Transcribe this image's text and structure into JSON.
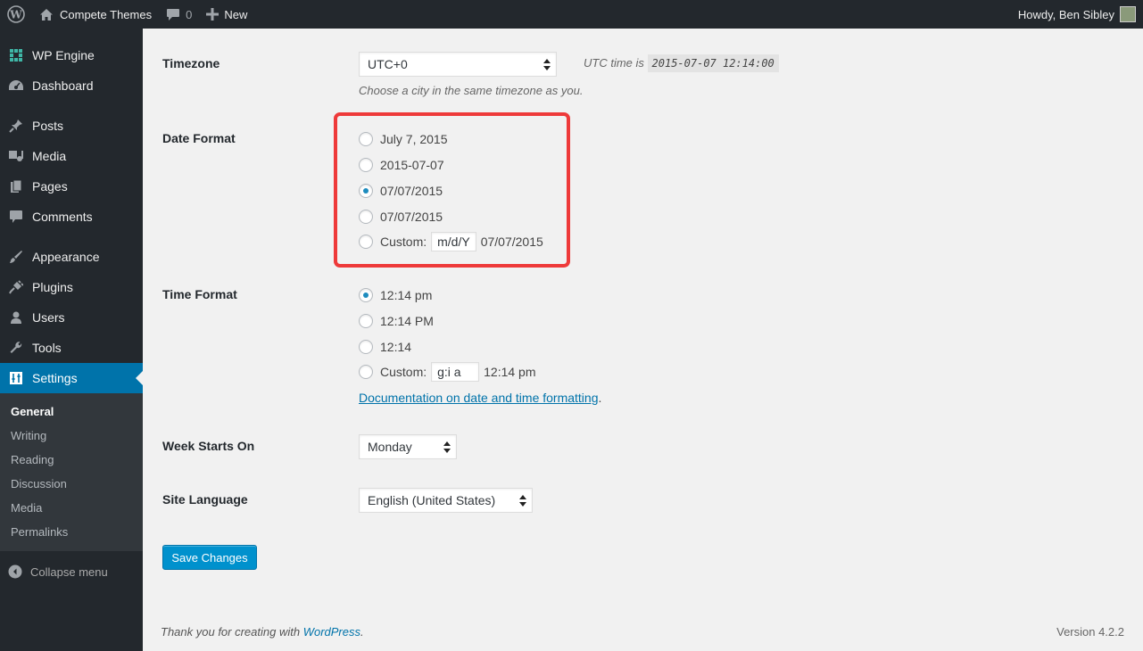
{
  "adminbar": {
    "site_name": "Compete Themes",
    "comments_count": "0",
    "new_label": "New",
    "howdy": "Howdy, Ben Sibley"
  },
  "sidebar": {
    "items": [
      {
        "label": "WP Engine",
        "icon": "wp-engine-icon"
      },
      {
        "label": "Dashboard",
        "icon": "dashboard-icon"
      },
      {
        "label": "Posts",
        "icon": "pin-icon"
      },
      {
        "label": "Media",
        "icon": "media-icon"
      },
      {
        "label": "Pages",
        "icon": "pages-icon"
      },
      {
        "label": "Comments",
        "icon": "comment-icon"
      },
      {
        "label": "Appearance",
        "icon": "brush-icon"
      },
      {
        "label": "Plugins",
        "icon": "plugin-icon"
      },
      {
        "label": "Users",
        "icon": "user-icon"
      },
      {
        "label": "Tools",
        "icon": "wrench-icon"
      },
      {
        "label": "Settings",
        "icon": "settings-icon"
      }
    ],
    "submenu": [
      "General",
      "Writing",
      "Reading",
      "Discussion",
      "Media",
      "Permalinks"
    ],
    "collapse_label": "Collapse menu"
  },
  "timezone": {
    "label": "Timezone",
    "value": "UTC+0",
    "utc_prefix": "UTC time is",
    "utc_time": "2015-07-07 12:14:00",
    "description": "Choose a city in the same timezone as you."
  },
  "date_format": {
    "label": "Date Format",
    "options": [
      "July 7, 2015",
      "2015-07-07",
      "07/07/2015",
      "07/07/2015"
    ],
    "selected_index": 2,
    "custom_label": "Custom:",
    "custom_value": "m/d/Y",
    "custom_preview": "07/07/2015"
  },
  "time_format": {
    "label": "Time Format",
    "options": [
      "12:14 pm",
      "12:14 PM",
      "12:14"
    ],
    "selected_index": 0,
    "custom_label": "Custom:",
    "custom_value": "g:i a",
    "custom_preview": "12:14 pm",
    "doc_link": "Documentation on date and time formatting",
    "doc_suffix": "."
  },
  "week_starts": {
    "label": "Week Starts On",
    "value": "Monday"
  },
  "site_language": {
    "label": "Site Language",
    "value": "English (United States)"
  },
  "save_label": "Save Changes",
  "footer": {
    "thanks_prefix": "Thank you for creating with ",
    "wp_link": "WordPress",
    "thanks_suffix": ".",
    "version": "Version 4.2.2"
  },
  "colors": {
    "accent": "#0073aa",
    "highlight": "#ee3a3a",
    "sidebar_bg": "#23282d"
  }
}
